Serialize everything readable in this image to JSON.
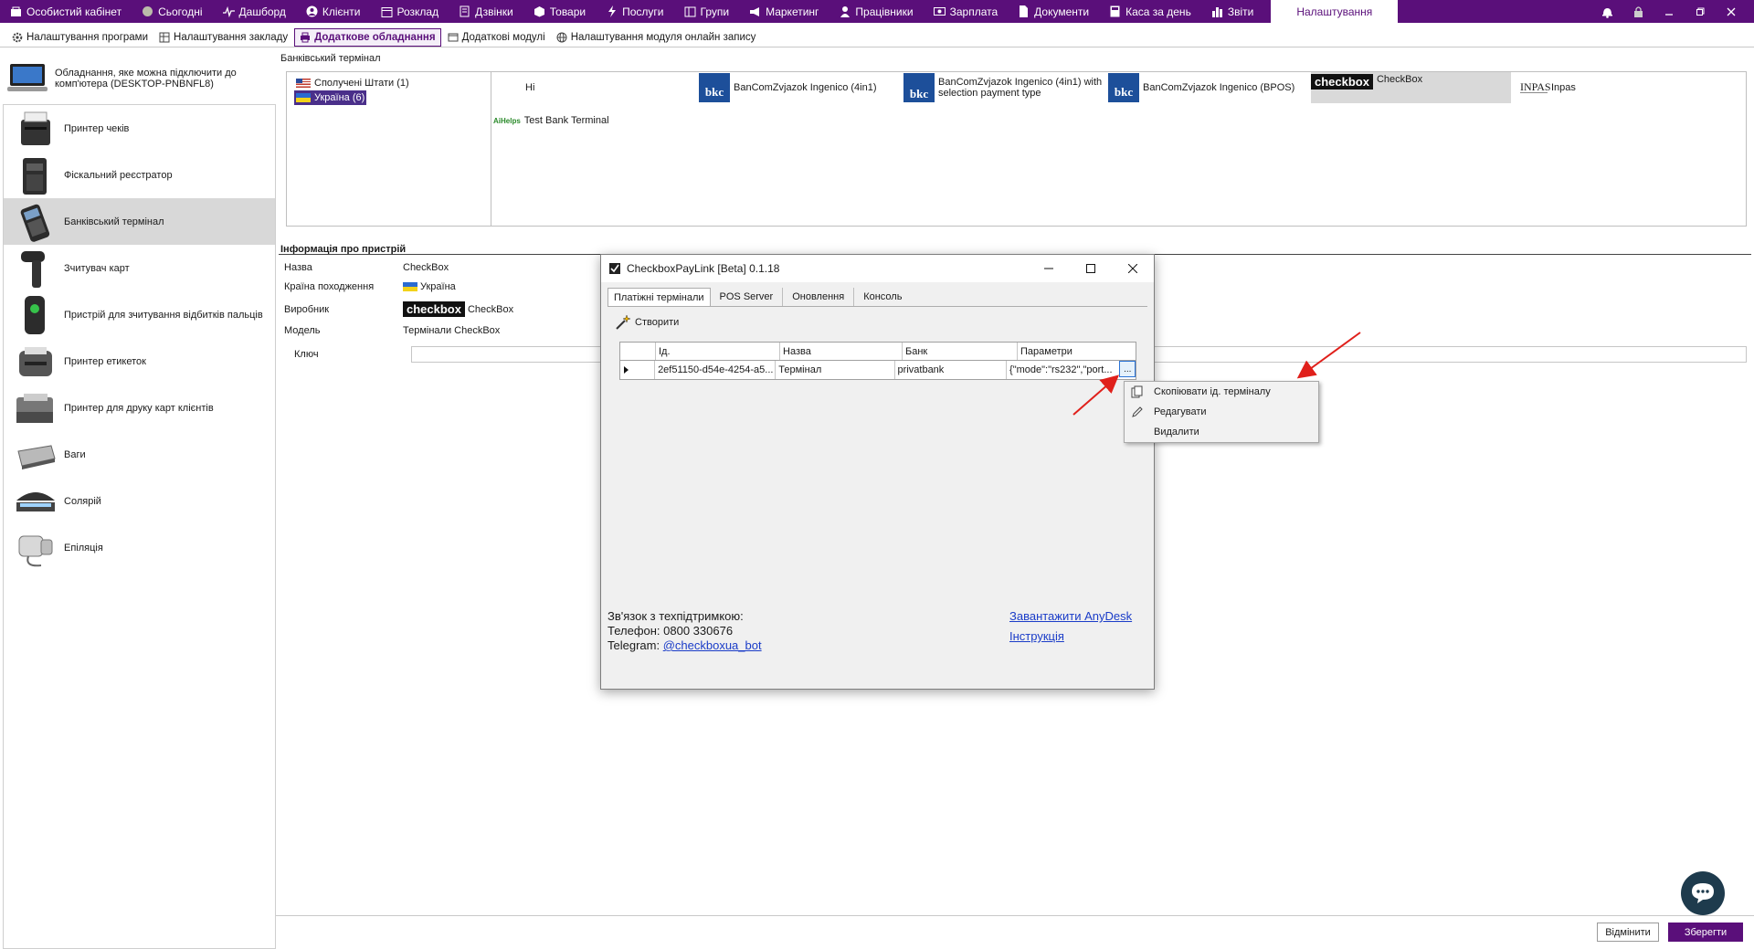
{
  "topnav": {
    "items": [
      {
        "label": "Особистий кабінет",
        "icon": "cabinet-icon"
      },
      {
        "label": "Сьогодні",
        "icon": "today-icon"
      },
      {
        "label": "Дашборд",
        "icon": "pulse-icon"
      },
      {
        "label": "Клієнти",
        "icon": "user-circle-icon"
      },
      {
        "label": "Розклад",
        "icon": "calendar-icon"
      },
      {
        "label": "Дзвінки",
        "icon": "phone-icon"
      },
      {
        "label": "Товари",
        "icon": "box-icon"
      },
      {
        "label": "Послуги",
        "icon": "lightning-icon"
      },
      {
        "label": "Групи",
        "icon": "groups-icon"
      },
      {
        "label": "Маркетинг",
        "icon": "megaphone-icon"
      },
      {
        "label": "Працівники",
        "icon": "person-icon"
      },
      {
        "label": "Зарплата",
        "icon": "money-icon"
      },
      {
        "label": "Документи",
        "icon": "document-icon"
      },
      {
        "label": "Каса за день",
        "icon": "calculator-icon"
      },
      {
        "label": "Звіти",
        "icon": "bar-chart-icon"
      }
    ],
    "active": "Налаштування"
  },
  "subnav": {
    "items": [
      {
        "label": "Налаштування програми",
        "icon": "gear-icon"
      },
      {
        "label": "Налаштування закладу",
        "icon": "building-icon"
      },
      {
        "label": "Додаткове обладнання",
        "icon": "printer-icon"
      },
      {
        "label": "Додаткові модулі",
        "icon": "module-icon"
      },
      {
        "label": "Налаштування модуля онлайн запису",
        "icon": "globe-icon"
      }
    ]
  },
  "left": {
    "connected_text": "Обладнання, яке можна підключити до комп'ютера (DESKTOP-PNBNFL8)",
    "devices": [
      "Принтер чеків",
      "Фіскальний реєстратор",
      "Банківський термінал",
      "Зчитувач карт",
      "Пристрій для зчитування відбитків пальців",
      "Принтер етикеток",
      "Принтер для друку карт клієнтів",
      "Ваги",
      "Солярій",
      "Епіляція"
    ]
  },
  "main": {
    "section_title": "Банківський термінал",
    "countries": [
      "Сполучені Штати (1)",
      "Україна (6)"
    ],
    "terminals": {
      "hi": "Hi",
      "bancom1": "BanComZvjazok Ingenico (4in1)",
      "bancom2_l1": "BanComZvjazok Ingenico (4in1) with",
      "bancom2_l2": "selection payment type",
      "bancom3": "BanComZvjazok Ingenico (BPOS)",
      "checkbox_logo": "checkbox",
      "checkbox": "CheckBox",
      "inpas_logo": "INPAS",
      "inpas": "Inpas",
      "aihelps_logo": "AiHelps",
      "test": "Test Bank Terminal",
      "bkc_logo": "bkc"
    },
    "info": {
      "title": "Інформація про пристрій",
      "name_label": "Назва",
      "name_value": "CheckBox",
      "country_label": "Країна походження",
      "country_value": "Україна",
      "vendor_label": "Виробник",
      "vendor_logo": "checkbox",
      "vendor_value": "CheckBox",
      "model_label": "Модель",
      "model_value": "Термінали CheckBox",
      "key_label": "Ключ",
      "key_value": ""
    },
    "buttons": {
      "cancel": "Відмінити",
      "save": "Зберегти"
    }
  },
  "dialog": {
    "title": "CheckboxPayLink [Beta] 0.1.18",
    "tabs": [
      "Платіжні термінали",
      "POS Server",
      "Оновлення",
      "Консоль"
    ],
    "create_label": "Створити",
    "columns": [
      "Ід.",
      "Назва",
      "Банк",
      "Параметри"
    ],
    "rows": [
      {
        "id": "2ef51150-d54e-4254-a5...",
        "name": "Термінал",
        "bank": "privatbank",
        "params": "{\"mode\":\"rs232\",\"port...",
        "more": "..."
      }
    ],
    "footer": {
      "support": "Зв'язок з техпідтримкою:",
      "phone": "Телефон: 0800 330676",
      "telegram_label": "Telegram:",
      "telegram_link": "@checkboxua_bot",
      "anydesk": "Завантажити AnyDesk",
      "manual": "Інструкція"
    }
  },
  "context_menu": {
    "items": [
      {
        "label": "Скопіювати ід. терміналу",
        "icon": "copy-icon"
      },
      {
        "label": "Редагувати",
        "icon": "pencil-icon"
      },
      {
        "label": "Видалити",
        "icon": ""
      }
    ]
  },
  "colors": {
    "brand": "#5a0f7a",
    "selection": "#4a2f8a",
    "annotation_arrow": "#e0201b"
  }
}
